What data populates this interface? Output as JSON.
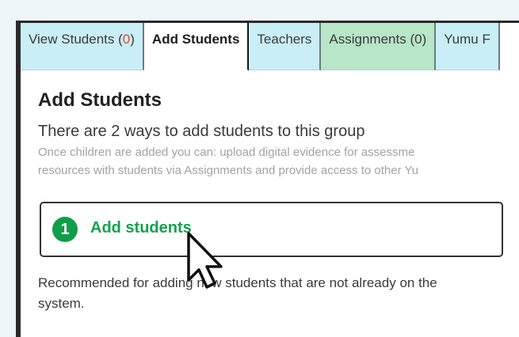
{
  "tabs": [
    {
      "name": "View Students",
      "count": "0",
      "style": "blue",
      "active": false
    },
    {
      "name": "Add Students",
      "count": null,
      "style": "active",
      "active": true
    },
    {
      "name": "Teachers",
      "count": null,
      "style": "blue",
      "active": false
    },
    {
      "name": "Assignments",
      "count": "0",
      "style": "green",
      "active": false
    },
    {
      "name": "Yumu F",
      "count": null,
      "style": "blue",
      "active": false
    }
  ],
  "main": {
    "title": "Add Students",
    "subtitle": "There are 2 ways to add students to this group",
    "description_line1": "Once children are added you can: upload digital evidence for assessme",
    "description_line2": "resources with students via Assignments and provide access to other Yu",
    "option1": {
      "number": "1",
      "label": "Add students"
    },
    "note_line1": "Recommended for adding new students that are not already on the",
    "note_line2": "system."
  },
  "colors": {
    "accent_green": "#15a04f",
    "tab_blue": "#c9eef6",
    "tab_green": "#b8e6c9",
    "count_red": "#e4462a"
  }
}
